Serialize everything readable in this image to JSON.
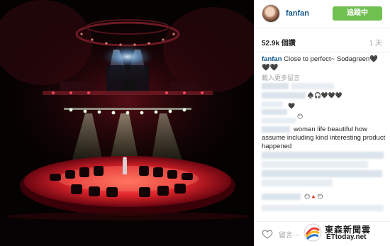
{
  "post": {
    "username": "fanfan",
    "follow_label": "追蹤中",
    "likes": "52.9k 個讚",
    "time": "1 天",
    "caption_user": "fanfan",
    "caption_text": "Close to perfect~ Sodagreen🖤🖤🖤",
    "load_more": "載入更多留言"
  },
  "comments": {
    "c1_emoji": "♠️🎧🖤🖤🖤",
    "c2_emoji": "🖤",
    "c3_emoji": "😶",
    "c4_text": "woman life beautiful how assume including kind interesting product happened",
    "c5_emoji": "😶🔺😶"
  },
  "comment_placeholder": "留言⋯",
  "watermark": {
    "name": "東森新聞雲",
    "domain": "ETtoday.net"
  },
  "colors": {
    "accent": "#70c050",
    "link": "#125688"
  }
}
